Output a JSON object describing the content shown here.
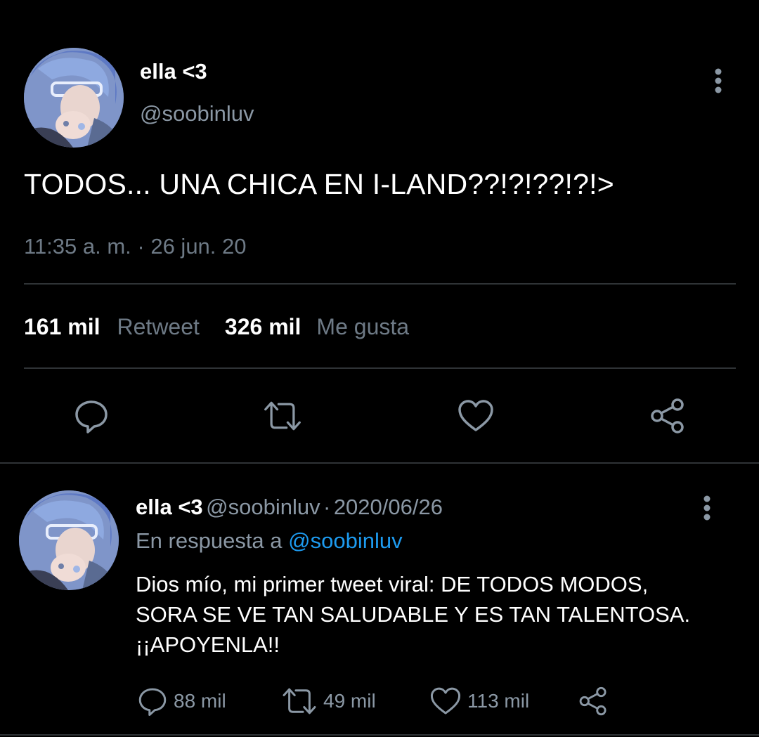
{
  "main_tweet": {
    "author": {
      "display_name": "ella <3",
      "handle": "@soobinluv"
    },
    "text": "TODOS... UNA CHICA EN I-LAND??!?!??!?!>",
    "timestamp": "11:35 a. m. · 26 jun. 20",
    "stats": {
      "retweets_count": "161 mil",
      "retweets_label": "Retweet",
      "likes_count": "326 mil",
      "likes_label": "Me gusta"
    },
    "actions": [
      "reply-icon",
      "retweet-icon",
      "heart-icon",
      "share-icon"
    ],
    "more_icon": "more-vertical-icon"
  },
  "reply_tweet": {
    "author": {
      "display_name": "ella <3",
      "handle": "@soobinluv"
    },
    "separator": "·",
    "date": "2020/06/26",
    "in_reply_prefix": "En respuesta a",
    "in_reply_to": "@soobinluv",
    "text": "Dios mío, mi primer tweet viral: DE TODOS MODOS, SORA SE VE TAN SALUDABLE Y ES TAN TALENTOSA. ¡¡APOYENLA!!",
    "replies": "88 mil",
    "retweets": "49 mil",
    "likes": "113 mil",
    "more_icon": "more-vertical-icon"
  },
  "colors": {
    "background": "#000000",
    "primary_text": "#ffffff",
    "secondary_text": "#8b98a5",
    "muted_text": "#6e7a86",
    "divider": "#2f3336",
    "link": "#1d9bf0",
    "icon": "#8b98a5"
  }
}
